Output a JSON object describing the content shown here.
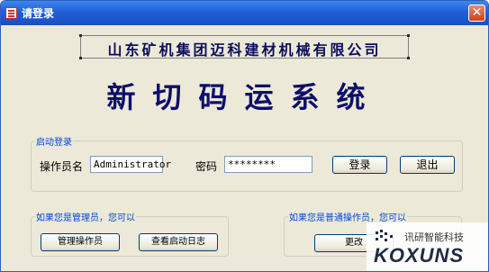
{
  "window": {
    "title": "请登录",
    "close_label": "✕"
  },
  "company": "山东矿机集团迈科建材机械有限公司",
  "system_title": "新切码运系统",
  "login_group": {
    "legend": "启动登录",
    "operator_label": "操作员名",
    "operator_value": "Administrator",
    "password_label": "密码",
    "password_value": "********",
    "login_button": "登录",
    "exit_button": "退出"
  },
  "admin_group": {
    "legend": "如果您是管理员，您可以",
    "manage_button": "管理操作员",
    "log_button": "查看启动日志"
  },
  "user_group": {
    "legend": "如果您是普通操作员，您可以",
    "change_button": "更改"
  },
  "watermark": {
    "cn": "讯研智能科技",
    "en": "KOXUNS"
  },
  "colors": {
    "title_bar": "#1f5fd8",
    "background": "#ece9d8",
    "accent_text": "#0046d5"
  }
}
